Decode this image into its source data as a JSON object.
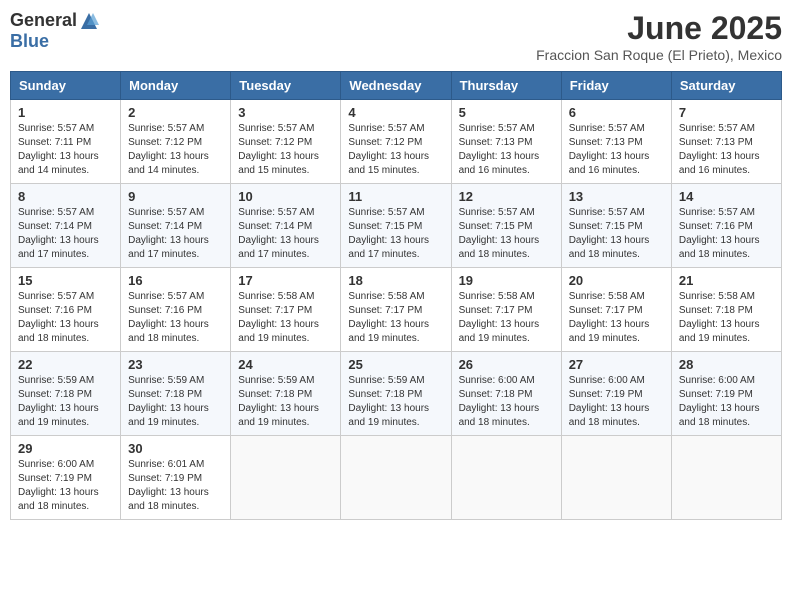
{
  "header": {
    "logo_general": "General",
    "logo_blue": "Blue",
    "title": "June 2025",
    "subtitle": "Fraccion San Roque (El Prieto), Mexico"
  },
  "days_of_week": [
    "Sunday",
    "Monday",
    "Tuesday",
    "Wednesday",
    "Thursday",
    "Friday",
    "Saturday"
  ],
  "weeks": [
    [
      {
        "day": "1",
        "sunrise": "5:57 AM",
        "sunset": "7:11 PM",
        "daylight": "13 hours and 14 minutes."
      },
      {
        "day": "2",
        "sunrise": "5:57 AM",
        "sunset": "7:12 PM",
        "daylight": "13 hours and 14 minutes."
      },
      {
        "day": "3",
        "sunrise": "5:57 AM",
        "sunset": "7:12 PM",
        "daylight": "13 hours and 15 minutes."
      },
      {
        "day": "4",
        "sunrise": "5:57 AM",
        "sunset": "7:12 PM",
        "daylight": "13 hours and 15 minutes."
      },
      {
        "day": "5",
        "sunrise": "5:57 AM",
        "sunset": "7:13 PM",
        "daylight": "13 hours and 16 minutes."
      },
      {
        "day": "6",
        "sunrise": "5:57 AM",
        "sunset": "7:13 PM",
        "daylight": "13 hours and 16 minutes."
      },
      {
        "day": "7",
        "sunrise": "5:57 AM",
        "sunset": "7:13 PM",
        "daylight": "13 hours and 16 minutes."
      }
    ],
    [
      {
        "day": "8",
        "sunrise": "5:57 AM",
        "sunset": "7:14 PM",
        "daylight": "13 hours and 17 minutes."
      },
      {
        "day": "9",
        "sunrise": "5:57 AM",
        "sunset": "7:14 PM",
        "daylight": "13 hours and 17 minutes."
      },
      {
        "day": "10",
        "sunrise": "5:57 AM",
        "sunset": "7:14 PM",
        "daylight": "13 hours and 17 minutes."
      },
      {
        "day": "11",
        "sunrise": "5:57 AM",
        "sunset": "7:15 PM",
        "daylight": "13 hours and 17 minutes."
      },
      {
        "day": "12",
        "sunrise": "5:57 AM",
        "sunset": "7:15 PM",
        "daylight": "13 hours and 18 minutes."
      },
      {
        "day": "13",
        "sunrise": "5:57 AM",
        "sunset": "7:15 PM",
        "daylight": "13 hours and 18 minutes."
      },
      {
        "day": "14",
        "sunrise": "5:57 AM",
        "sunset": "7:16 PM",
        "daylight": "13 hours and 18 minutes."
      }
    ],
    [
      {
        "day": "15",
        "sunrise": "5:57 AM",
        "sunset": "7:16 PM",
        "daylight": "13 hours and 18 minutes."
      },
      {
        "day": "16",
        "sunrise": "5:57 AM",
        "sunset": "7:16 PM",
        "daylight": "13 hours and 18 minutes."
      },
      {
        "day": "17",
        "sunrise": "5:58 AM",
        "sunset": "7:17 PM",
        "daylight": "13 hours and 19 minutes."
      },
      {
        "day": "18",
        "sunrise": "5:58 AM",
        "sunset": "7:17 PM",
        "daylight": "13 hours and 19 minutes."
      },
      {
        "day": "19",
        "sunrise": "5:58 AM",
        "sunset": "7:17 PM",
        "daylight": "13 hours and 19 minutes."
      },
      {
        "day": "20",
        "sunrise": "5:58 AM",
        "sunset": "7:17 PM",
        "daylight": "13 hours and 19 minutes."
      },
      {
        "day": "21",
        "sunrise": "5:58 AM",
        "sunset": "7:18 PM",
        "daylight": "13 hours and 19 minutes."
      }
    ],
    [
      {
        "day": "22",
        "sunrise": "5:59 AM",
        "sunset": "7:18 PM",
        "daylight": "13 hours and 19 minutes."
      },
      {
        "day": "23",
        "sunrise": "5:59 AM",
        "sunset": "7:18 PM",
        "daylight": "13 hours and 19 minutes."
      },
      {
        "day": "24",
        "sunrise": "5:59 AM",
        "sunset": "7:18 PM",
        "daylight": "13 hours and 19 minutes."
      },
      {
        "day": "25",
        "sunrise": "5:59 AM",
        "sunset": "7:18 PM",
        "daylight": "13 hours and 19 minutes."
      },
      {
        "day": "26",
        "sunrise": "6:00 AM",
        "sunset": "7:18 PM",
        "daylight": "13 hours and 18 minutes."
      },
      {
        "day": "27",
        "sunrise": "6:00 AM",
        "sunset": "7:19 PM",
        "daylight": "13 hours and 18 minutes."
      },
      {
        "day": "28",
        "sunrise": "6:00 AM",
        "sunset": "7:19 PM",
        "daylight": "13 hours and 18 minutes."
      }
    ],
    [
      {
        "day": "29",
        "sunrise": "6:00 AM",
        "sunset": "7:19 PM",
        "daylight": "13 hours and 18 minutes."
      },
      {
        "day": "30",
        "sunrise": "6:01 AM",
        "sunset": "7:19 PM",
        "daylight": "13 hours and 18 minutes."
      },
      null,
      null,
      null,
      null,
      null
    ]
  ]
}
